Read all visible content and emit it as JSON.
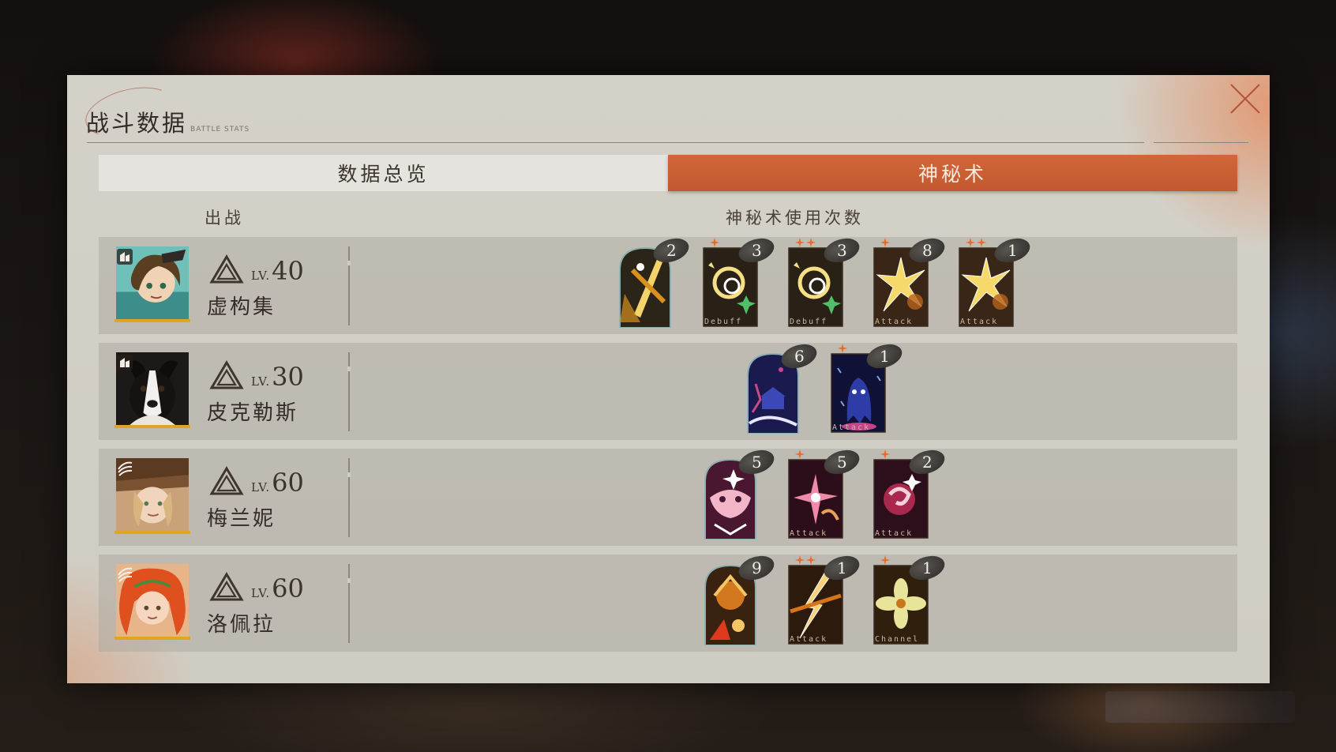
{
  "window": {
    "title": "战斗数据",
    "subtitle": "BATTLE STATS"
  },
  "tabs": [
    {
      "label": "数据总览",
      "active": false
    },
    {
      "label": "神秘术",
      "active": true
    }
  ],
  "columns": {
    "deployed": "出战",
    "arcanum_uses": "神秘术使用次数"
  },
  "level_prefix": "LV.",
  "colors": {
    "accent": "#c85e33",
    "panel": "#d1cec5",
    "row": "#b4b1a9"
  },
  "characters": [
    {
      "name": "虚构集",
      "level": "40",
      "avatar_icon": "curly-hair-character-portrait",
      "cards": [
        {
          "count": "2",
          "stars": 0,
          "type": "",
          "icon": "pen-nib-icon",
          "shape": "arch"
        },
        {
          "count": "3",
          "stars": 1,
          "type": "Debuff",
          "icon": "swirl-sparkle-icon",
          "shape": "rect"
        },
        {
          "count": "3",
          "stars": 2,
          "type": "Debuff",
          "icon": "swirl-sparkle-icon",
          "shape": "rect"
        },
        {
          "count": "8",
          "stars": 1,
          "type": "Attack",
          "icon": "starburst-icon",
          "shape": "rect"
        },
        {
          "count": "1",
          "stars": 2,
          "type": "Attack",
          "icon": "starburst-icon",
          "shape": "rect"
        }
      ]
    },
    {
      "name": "皮克勒斯",
      "level": "30",
      "avatar_icon": "dog-portrait",
      "cards": [
        {
          "count": "6",
          "stars": 0,
          "type": "",
          "icon": "night-temple-icon",
          "shape": "arch"
        },
        {
          "count": "1",
          "stars": 1,
          "type": "Attack",
          "icon": "ghost-figure-icon",
          "shape": "rect"
        }
      ]
    },
    {
      "name": "梅兰妮",
      "level": "60",
      "avatar_icon": "hat-character-portrait",
      "cards": [
        {
          "count": "5",
          "stars": 0,
          "type": "",
          "icon": "pink-mask-icon",
          "shape": "arch"
        },
        {
          "count": "5",
          "stars": 1,
          "type": "Attack",
          "icon": "pink-burst-icon",
          "shape": "rect"
        },
        {
          "count": "2",
          "stars": 1,
          "type": "Attack",
          "icon": "pink-swirl-icon",
          "shape": "rect"
        }
      ]
    },
    {
      "name": "洛佩拉",
      "level": "60",
      "avatar_icon": "red-hair-character-portrait",
      "cards": [
        {
          "count": "9",
          "stars": 0,
          "type": "",
          "icon": "golden-creature-icon",
          "shape": "arch"
        },
        {
          "count": "1",
          "stars": 2,
          "type": "Attack",
          "icon": "lightning-strike-icon",
          "shape": "rect"
        },
        {
          "count": "1",
          "stars": 1,
          "type": "Channel",
          "icon": "flower-icon",
          "shape": "rect"
        }
      ]
    }
  ]
}
